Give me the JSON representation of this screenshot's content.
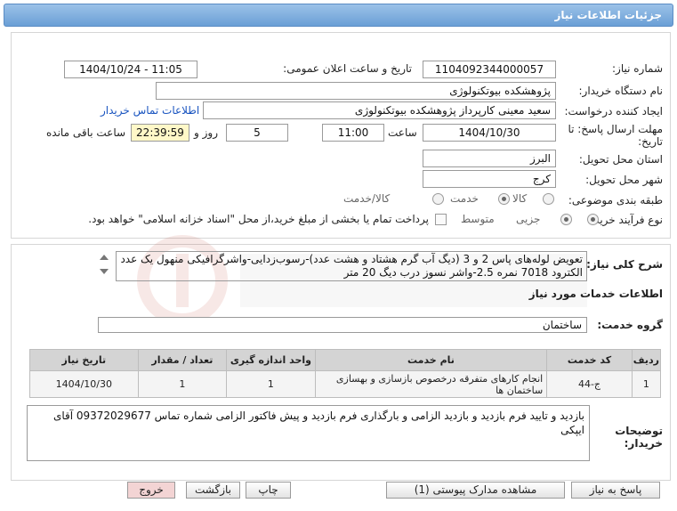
{
  "header": {
    "title": "جزئیات اطلاعات نیاز"
  },
  "form": {
    "need_number": {
      "label": "شماره نیاز:",
      "value": "1104092344000057"
    },
    "announce_datetime": {
      "label": "تاریخ و ساعت اعلان عمومی:",
      "value": "1404/10/24 - 11:05"
    },
    "buyer_org": {
      "label": "نام دستگاه خریدار:",
      "value": "پژوهشکده بیوتکنولوژی"
    },
    "requester": {
      "label": "ایجاد کننده درخواست:",
      "value": "سعید معینی کارپرداز پژوهشکده بیوتکنولوژی"
    },
    "buyer_contact_link": "اطلاعات تماس خریدار",
    "deadline": {
      "label_line1": "مهلت ارسال پاسخ: تا",
      "label_line2": "تاریخ:",
      "date": "1404/10/30",
      "time_label": "ساعت",
      "time": "11:00",
      "days": "5",
      "days_label": "روز و",
      "remaining": "22:39:59",
      "remaining_label": "ساعت باقی مانده"
    },
    "province": {
      "label": "استان محل تحویل:",
      "value": "البرز"
    },
    "city": {
      "label": "شهر محل تحویل:",
      "value": "کرج"
    },
    "category": {
      "label": "طبقه بندی موضوعی:",
      "options": [
        "کالا",
        "خدمت",
        "کالا/خدمت"
      ],
      "selected": "خدمت"
    },
    "purchase_type": {
      "label": "نوع فرآیند خرید :",
      "options": [
        "جزیی",
        "متوسط"
      ],
      "selected": "جزیی",
      "note": "پرداخت تمام یا بخشی از مبلغ خرید،از محل \"اسناد خزانه اسلامی\" خواهد بود."
    }
  },
  "description": {
    "label": "شرح کلی نیاز:",
    "text": "تعویض لوله‌های پاس 2 و 3 (دیگ آب گرم هشتاد و هشت عدد)-رسوب‌زدایی-واشرگرافیکی منهول یک عدد الکترود 7018 نمره 2.5-واشر نسوز درب دیگ 20 متر"
  },
  "services_section": {
    "title": "اطلاعات خدمات مورد نیاز",
    "group_label": "گروه خدمت:",
    "group_value": "ساختمان",
    "table": {
      "headers": [
        "ردیف",
        "کد خدمت",
        "نام خدمت",
        "واحد اندازه گیری",
        "تعداد / مقدار",
        "تاریخ نیاز"
      ],
      "rows": [
        [
          "1",
          "ج-44",
          "انجام کارهای متفرقه درخصوص بازسازی و بهسازی ساختمان ها",
          "1",
          "1",
          "1404/10/30"
        ]
      ]
    }
  },
  "buyer_notes": {
    "label_line1": "توضیحات",
    "label_line2": "خریدار:",
    "text": "بازدید و تایید فرم بازدید و بازدید الزامی و بارگذاری فرم بازدید و پیش فاکتور الزامی شماره تماس 09372029677 آقای ایپکی"
  },
  "buttons": {
    "reply": "پاسخ به نیاز",
    "view_docs": "مشاهده مدارک پیوستی (1)",
    "print": "چاپ",
    "back": "بازگشت",
    "exit": "خروج"
  },
  "colors": {
    "header": "#7aa9dc",
    "link": "#1a55c0",
    "remaining_bg": "#fff8c8",
    "exit_bg": "#f3d4d4"
  }
}
